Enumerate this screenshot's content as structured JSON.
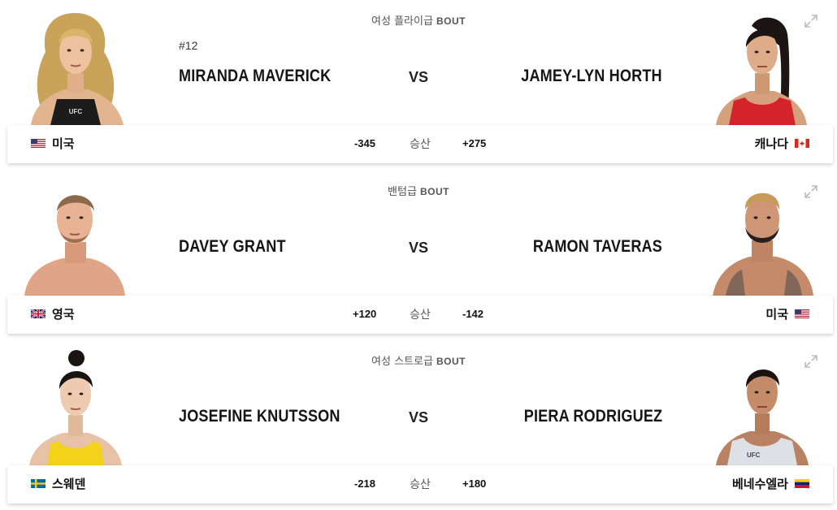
{
  "bouts": [
    {
      "weight_class": "여성 플라이급",
      "bout_word": "BOUT",
      "rank": "#12",
      "red_name": "MIRANDA MAVERICK",
      "blue_name": "JAMEY-LYN HORTH",
      "vs": "VS",
      "red_country": "미국",
      "blue_country": "캐나다",
      "red_odds": "-345",
      "blue_odds": "+275",
      "odds_label": "승산"
    },
    {
      "weight_class": "밴텀급",
      "bout_word": "BOUT",
      "red_name": "DAVEY GRANT",
      "blue_name": "RAMON TAVERAS",
      "vs": "VS",
      "red_country": "영국",
      "blue_country": "미국",
      "red_odds": "+120",
      "blue_odds": "-142",
      "odds_label": "승산"
    },
    {
      "weight_class": "여성 스트로급",
      "bout_word": "BOUT",
      "red_name": "JOSEFINE KNUTSSON",
      "blue_name": "PIERA RODRIGUEZ",
      "vs": "VS",
      "red_country": "스웨덴",
      "blue_country": "베네수엘라",
      "red_odds": "-218",
      "blue_odds": "+180",
      "odds_label": "승산"
    }
  ]
}
